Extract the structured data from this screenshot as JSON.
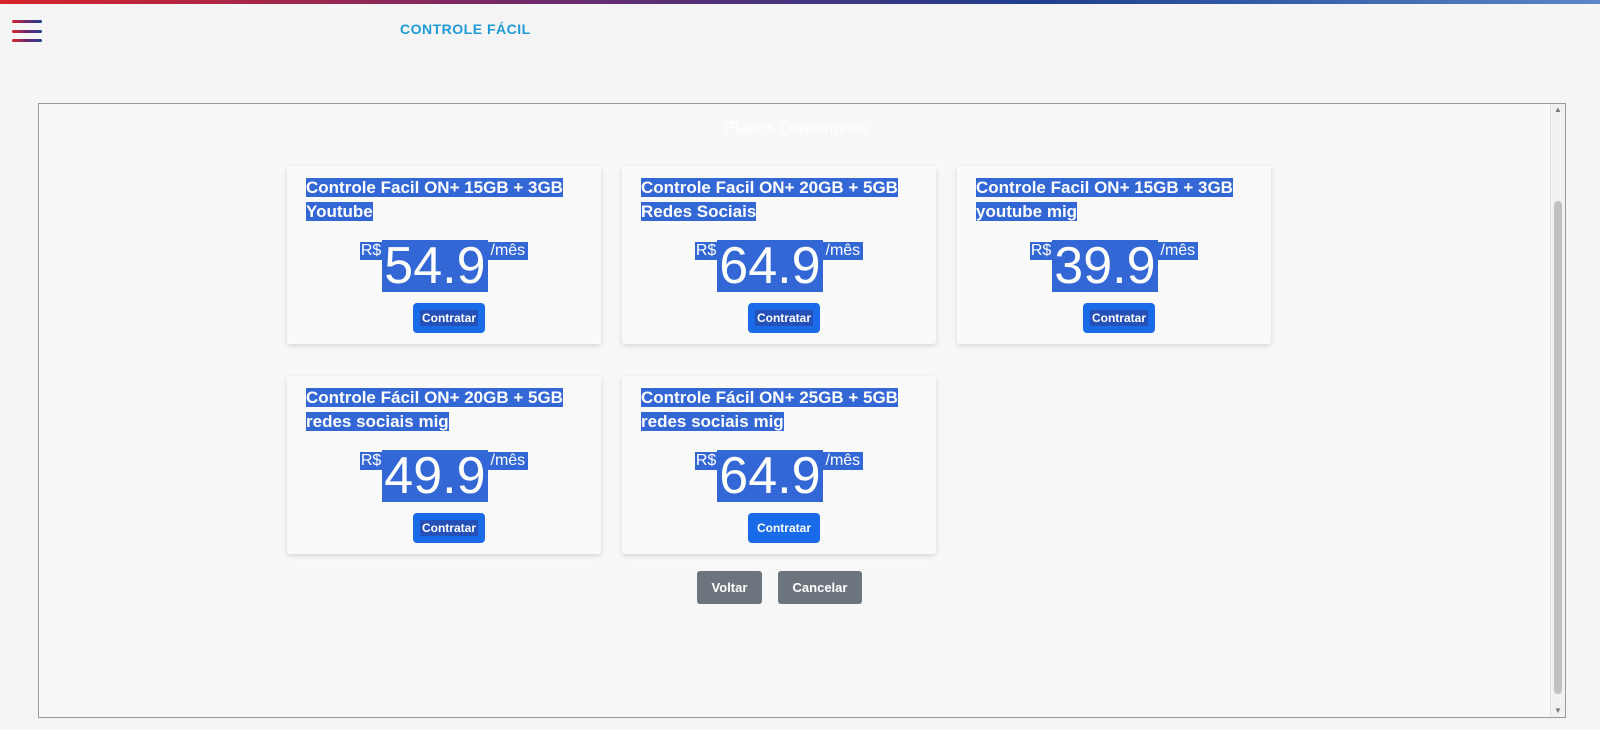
{
  "header": {
    "app_title": "CONTROLE FÁCIL",
    "menu_icon": "hamburger-menu-icon"
  },
  "main": {
    "section_title": "Planos Disponíveis",
    "plans": [
      {
        "title": "Controle Facil ON+ 15GB + 3GB Youtube",
        "currency": "R$",
        "amount": "54.9",
        "period": "/mês",
        "button": "Contratar"
      },
      {
        "title": "Controle Facil ON+ 20GB + 5GB Redes Sociais",
        "currency": "R$",
        "amount": "64.9",
        "period": "/mês",
        "button": "Contratar"
      },
      {
        "title": "Controle Facil ON+ 15GB + 3GB youtube mig",
        "currency": "R$",
        "amount": "39.9",
        "period": "/mês",
        "button": "Contratar"
      },
      {
        "title": "Controle Fácil ON+ 20GB + 5GB redes sociais mig",
        "currency": "R$",
        "amount": "49.9",
        "period": "/mês",
        "button": "Contratar"
      },
      {
        "title": "Controle Fácil ON+ 25GB + 5GB redes sociais mig",
        "currency": "R$",
        "amount": "64.9",
        "period": "/mês",
        "button": "Contratar"
      }
    ],
    "actions": {
      "back_label": "Voltar",
      "cancel_label": "Cancelar"
    }
  },
  "colors": {
    "accent": "#1e9ad6",
    "button_primary": "#1a6be8",
    "button_secondary": "#6c757d",
    "selection": "#3367d6"
  }
}
